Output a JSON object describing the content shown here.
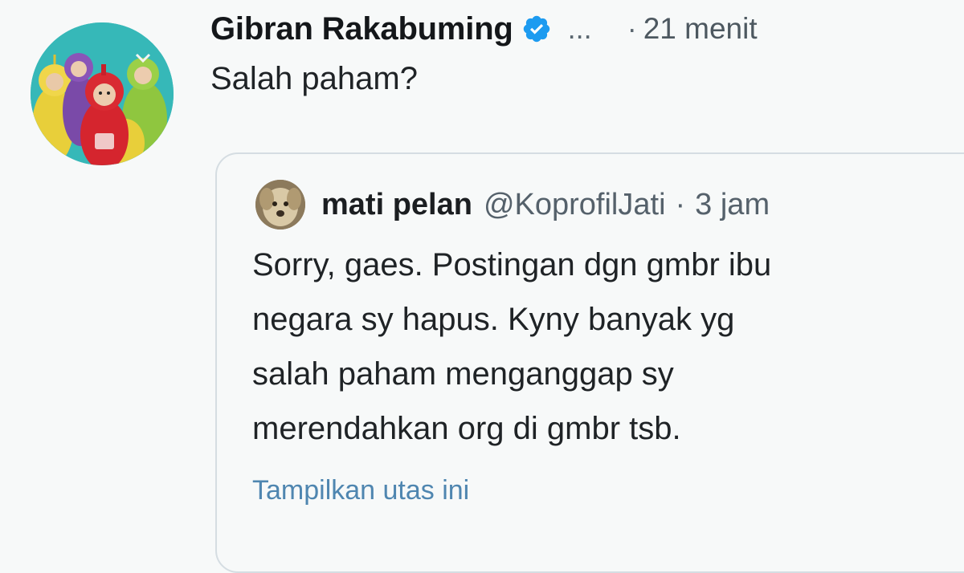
{
  "tweet": {
    "display_name": "Gibran Rakabuming",
    "verified_icon": "verified-badge-icon",
    "handle_truncated": "...",
    "separator": "·",
    "timestamp": "21 menit",
    "text": "Salah paham?",
    "avatar_icon": "profile-picture-teletubbies",
    "colors": {
      "verified_blue": "#1d9bf0",
      "avatar_bg": "#34b6b6",
      "link_blue": "#4f86b0"
    }
  },
  "quote": {
    "display_name": "mati pelan",
    "handle": "@KoprofilJati",
    "separator": "·",
    "timestamp": "3 jam",
    "body_lines": [
      "Sorry, gaes. Postingan dgn gmbr ibu",
      "negara sy hapus. Kyny banyak yg",
      "salah paham menganggap sy",
      "merendahkan org di gmbr tsb."
    ],
    "show_thread": "Tampilkan utas ini",
    "avatar_icon": "profile-picture-dog"
  }
}
